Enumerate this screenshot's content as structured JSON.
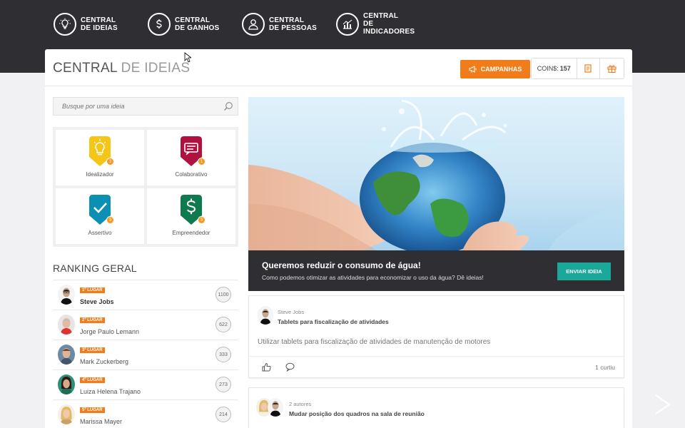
{
  "nav": [
    {
      "line1": "CENTRAL",
      "line2": "DE IDEIAS",
      "icon": "lightbulb-icon"
    },
    {
      "line1": "CENTRAL",
      "line2": "DE GANHOS",
      "icon": "dollar-icon"
    },
    {
      "line1": "CENTRAL",
      "line2": "DE PESSOAS",
      "icon": "person-icon"
    },
    {
      "line1": "CENTRAL",
      "line2": "DE INDICADORES",
      "icon": "chart-icon"
    }
  ],
  "header": {
    "title_main": "CENTRAL",
    "title_light": " DE IDEIAS",
    "campaigns_label": "CAMPANHAS",
    "coins_label": "COIN$:",
    "coins_value": "157"
  },
  "search": {
    "placeholder": "Busque por uma ideia"
  },
  "badges": [
    {
      "name": "Idealizador",
      "count": "3",
      "color": "#f5c518",
      "icon": "lightbulb-icon"
    },
    {
      "name": "Colaborativo",
      "count": "1",
      "color": "#b0123f",
      "icon": "chat-icon"
    },
    {
      "name": "Assertivo",
      "count": "3",
      "color": "#0b8fb5",
      "icon": "check-icon"
    },
    {
      "name": "Empreendedor",
      "count": "3",
      "color": "#0f7a4e",
      "icon": "dollar-icon"
    }
  ],
  "ranking": {
    "title": "RANKING GERAL",
    "rows": [
      {
        "place": "1º LUGAR",
        "name": "Steve Jobs",
        "score": "1100"
      },
      {
        "place": "2º LUGAR",
        "name": "Jorge Paulo Lemann",
        "score": "622"
      },
      {
        "place": "3º LUGAR",
        "name": "Mark Zuckerberg",
        "score": "333"
      },
      {
        "place": "4º LUGAR",
        "name": "Luiza Helena Trajano",
        "score": "273"
      },
      {
        "place": "5º LUGAR",
        "name": "Marissa Mayer",
        "score": "214"
      }
    ]
  },
  "banner": {
    "title": "Queremos reduzir o consumo de água!",
    "subtitle": "Como podemos otimizar as atividades para economizar o uso da água? Dê ideias!",
    "button": "ENVIAR IDEIA"
  },
  "posts": [
    {
      "author": "Steve Jobs",
      "title": "Tablets para fiscalização de atividades",
      "body": "Utilizar tablets para fiscalização de atividades de manutenção de motores",
      "likes": "1 curtiu"
    },
    {
      "author": "2 autores",
      "title": "Mudar posição dos quadros na sala de reunião"
    }
  ],
  "colors": {
    "accent": "#f07c1a",
    "dark": "#2f2e33",
    "teal": "#1aa89b"
  }
}
